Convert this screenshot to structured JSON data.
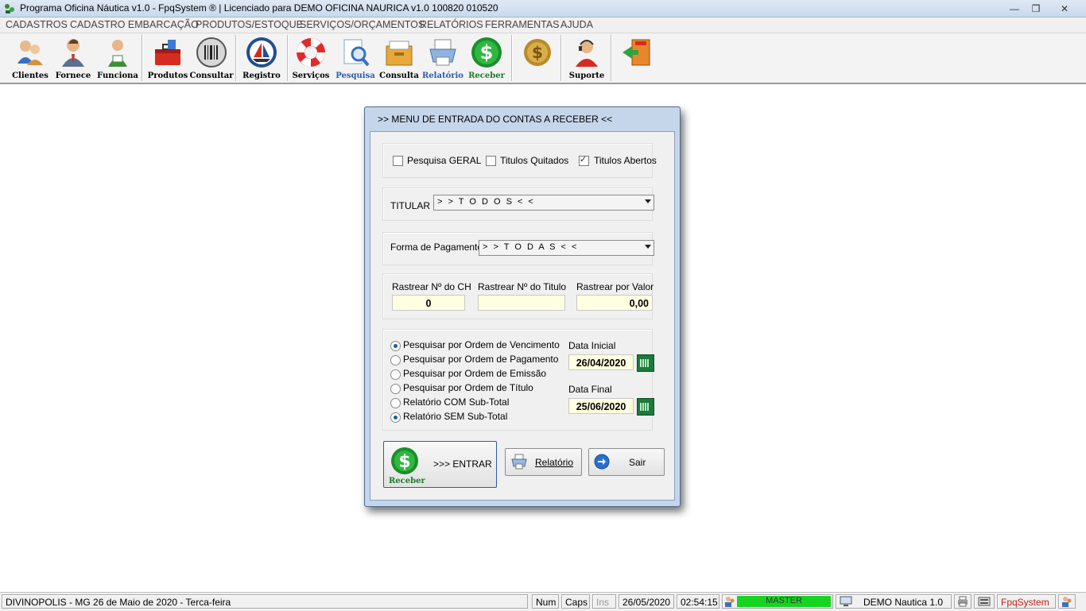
{
  "window": {
    "title": "Programa Oficina Náutica v1.0 - FpqSystem ® | Licenciado para  DEMO OFICINA NAURICA v1.0 100820 010520",
    "minimize_glyph": "—",
    "maximize_glyph": "❐",
    "close_glyph": "✕"
  },
  "menu": [
    {
      "label": "CADASTROS"
    },
    {
      "label": "CADASTRO EMBARCAÇÃO"
    },
    {
      "label": "PRODUTOS/ESTOQUE"
    },
    {
      "label": "SERVIÇOS/ORÇAMENTOS"
    },
    {
      "label": "RELATÓRIOS"
    },
    {
      "label": "FERRAMENTAS"
    },
    {
      "label": "AJUDA"
    }
  ],
  "toolbar": [
    {
      "label": "Clientes",
      "icon": "clients-icon"
    },
    {
      "label": "Fornece",
      "icon": "supplier-icon"
    },
    {
      "label": "Funciona",
      "icon": "employee-icon"
    },
    {
      "label": "Produtos",
      "icon": "toolbox-icon"
    },
    {
      "label": "Consultar",
      "icon": "barcode-icon"
    },
    {
      "label": "Registro",
      "icon": "sailboat-icon"
    },
    {
      "label": "Serviços",
      "icon": "lifebuoy-icon"
    },
    {
      "label": "Pesquisa",
      "icon": "magnifier-icon"
    },
    {
      "label": "Consulta",
      "icon": "file-box-icon"
    },
    {
      "label": "Relatório",
      "icon": "printer-icon"
    },
    {
      "label": "Receber",
      "icon": "dollar-icon"
    },
    {
      "label": "",
      "icon": "coins-icon"
    },
    {
      "label": "Suporte",
      "icon": "support-agent-icon"
    },
    {
      "label": "",
      "icon": "exit-door-icon"
    }
  ],
  "dialog": {
    "title": ">>  MENU DE ENTRADA DO CONTAS A RECEBER  <<",
    "checks": [
      {
        "label": "Pesquisa GERAL",
        "checked": false
      },
      {
        "label": "Titulos Quitados",
        "checked": false
      },
      {
        "label": "Titulos Abertos",
        "checked": true
      }
    ],
    "titular": {
      "label": "TITULAR",
      "value": "> > T O D O S < <"
    },
    "pagamento": {
      "label": "Forma de Pagamento",
      "value": "> > T O D A S < <"
    },
    "rastrear": {
      "ch_label": "Rastrear Nº do CH",
      "ch_value": "0",
      "titulo_label": "Rastrear Nº do Titulo",
      "titulo_value": "",
      "valor_label": "Rastrear por Valor",
      "valor_value": "0,00"
    },
    "radios": [
      {
        "label": "Pesquisar por Ordem de Vencimento",
        "checked": true
      },
      {
        "label": "Pesquisar por Ordem de Pagamento",
        "checked": false
      },
      {
        "label": "Pesquisar por Ordem de Emissão",
        "checked": false
      },
      {
        "label": "Pesquisar por Ordem de Título",
        "checked": false
      },
      {
        "label": "Relatório COM Sub-Total",
        "checked": false
      },
      {
        "label": "Relatório SEM Sub-Total",
        "checked": true
      }
    ],
    "data_inicial": {
      "label": "Data Inicial",
      "value": "26/04/2020"
    },
    "data_final": {
      "label": "Data Final",
      "value": "25/06/2020"
    },
    "buttons": {
      "entrar": ">>> ENTRAR",
      "entrar_icon_caption": "Receber",
      "relatorio": "Relatório",
      "sair": "Sair"
    }
  },
  "status": {
    "location": "DIVINOPOLIS - MG 26 de Maio de 2020 - Terca-feira",
    "num": "Num",
    "caps": "Caps",
    "ins": "Ins",
    "date": "26/05/2020",
    "time": "02:54:15",
    "user": "MASTER",
    "version": "DEMO Nautica 1.0",
    "brand": "FpqSystem"
  }
}
